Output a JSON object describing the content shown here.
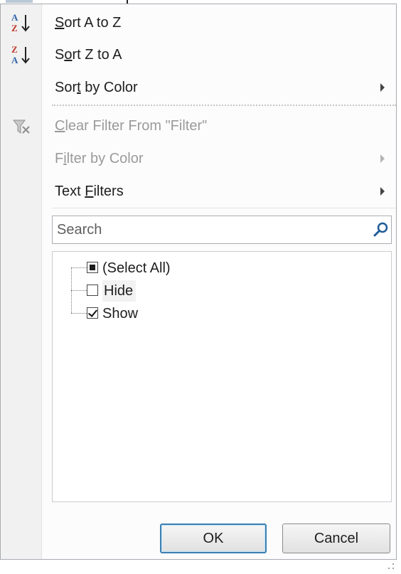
{
  "menu": {
    "sort_az": {
      "accel": "S",
      "rest": "ort A to Z"
    },
    "sort_za": {
      "pre": "S",
      "accel": "o",
      "rest": "rt Z to A"
    },
    "sort_by_color": {
      "pre": "Sor",
      "accel": "t",
      "rest": " by Color"
    },
    "clear_filter": {
      "accel": "C",
      "rest": "lear Filter From \"Filter\""
    },
    "filter_by_color": {
      "pre": "F",
      "accel": "i",
      "rest": "lter by Color"
    },
    "text_filters": {
      "pre": "Text ",
      "accel": "F",
      "rest": "ilters"
    }
  },
  "icons": {
    "sort_az": "sort-ascending-icon",
    "sort_za": "sort-descending-icon",
    "clear_filter": "clear-filter-icon",
    "search": "magnifier-icon"
  },
  "search": {
    "placeholder": "Search",
    "value": ""
  },
  "list": {
    "items": [
      {
        "label": "(Select All)",
        "state": "partial"
      },
      {
        "label": "Hide",
        "state": "unchecked"
      },
      {
        "label": "Show",
        "state": "checked"
      }
    ]
  },
  "buttons": {
    "ok": "OK",
    "cancel": "Cancel"
  },
  "colors": {
    "accent": "#3c7fb1",
    "disabled_text": "#9a9a9a",
    "search_icon": "#1f5c99"
  }
}
